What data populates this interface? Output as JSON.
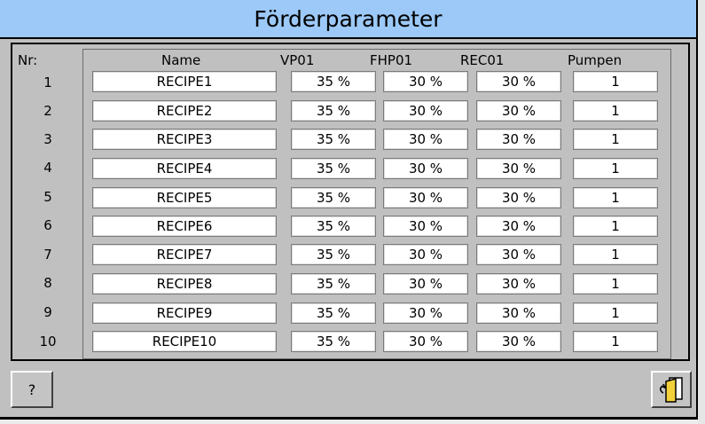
{
  "title": "Förderparameter",
  "headers": {
    "nr": "Nr:",
    "name": "Name",
    "vp": "VP01",
    "fhp": "FHP01",
    "rec": "REC01",
    "pumpen": "Pumpen"
  },
  "rows": [
    {
      "nr": "1",
      "name": "RECIPE1",
      "vp": "35 %",
      "fhp": "30 %",
      "rec": "30 %",
      "pumpen": "1"
    },
    {
      "nr": "2",
      "name": "RECIPE2",
      "vp": "35 %",
      "fhp": "30 %",
      "rec": "30 %",
      "pumpen": "1"
    },
    {
      "nr": "3",
      "name": "RECIPE3",
      "vp": "35 %",
      "fhp": "30 %",
      "rec": "30 %",
      "pumpen": "1"
    },
    {
      "nr": "4",
      "name": "RECIPE4",
      "vp": "35 %",
      "fhp": "30 %",
      "rec": "30 %",
      "pumpen": "1"
    },
    {
      "nr": "5",
      "name": "RECIPE5",
      "vp": "35 %",
      "fhp": "30 %",
      "rec": "30 %",
      "pumpen": "1"
    },
    {
      "nr": "6",
      "name": "RECIPE6",
      "vp": "35 %",
      "fhp": "30 %",
      "rec": "30 %",
      "pumpen": "1"
    },
    {
      "nr": "7",
      "name": "RECIPE7",
      "vp": "35 %",
      "fhp": "30 %",
      "rec": "30 %",
      "pumpen": "1"
    },
    {
      "nr": "8",
      "name": "RECIPE8",
      "vp": "35 %",
      "fhp": "30 %",
      "rec": "30 %",
      "pumpen": "1"
    },
    {
      "nr": "9",
      "name": "RECIPE9",
      "vp": "35 %",
      "fhp": "30 %",
      "rec": "30 %",
      "pumpen": "1"
    },
    {
      "nr": "10",
      "name": "RECIPE10",
      "vp": "35 %",
      "fhp": "30 %",
      "rec": "30 %",
      "pumpen": "1"
    }
  ],
  "buttons": {
    "help_label": "?",
    "back_icon": "back-document-icon"
  },
  "colors": {
    "title_bar": "#9cc9f7",
    "panel": "#c0c0c0",
    "field": "#ffffff"
  }
}
